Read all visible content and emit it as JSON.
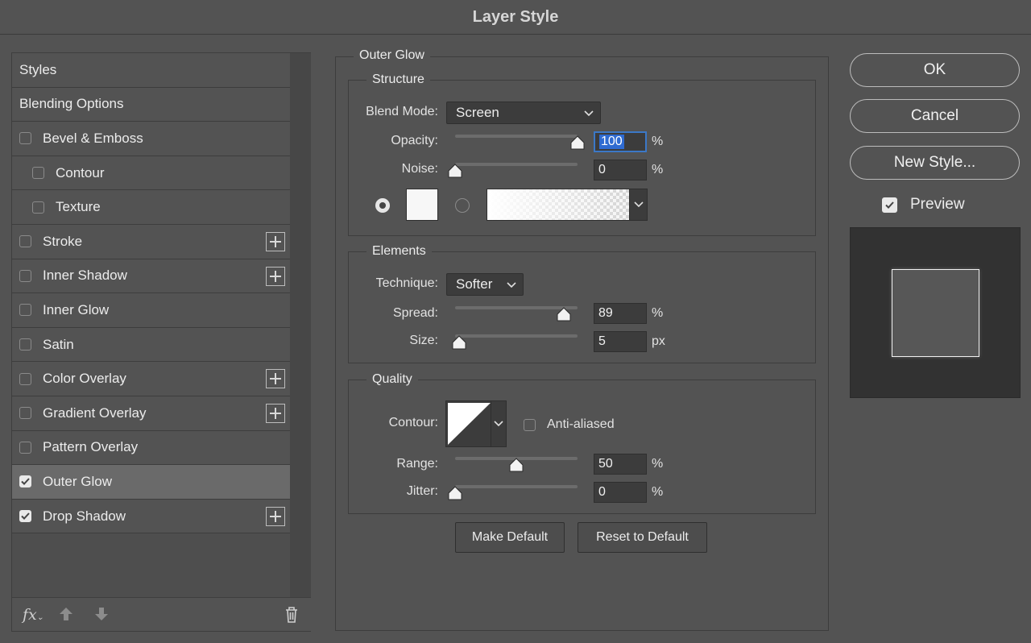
{
  "window": {
    "title": "Layer Style"
  },
  "style_list": {
    "items": [
      {
        "label": "Styles",
        "checkbox": false,
        "checked": false,
        "indent": false,
        "plus": false,
        "selected": false
      },
      {
        "label": "Blending Options",
        "checkbox": false,
        "checked": false,
        "indent": false,
        "plus": false,
        "selected": false
      },
      {
        "label": "Bevel & Emboss",
        "checkbox": true,
        "checked": false,
        "indent": false,
        "plus": false,
        "selected": false
      },
      {
        "label": "Contour",
        "checkbox": true,
        "checked": false,
        "indent": true,
        "plus": false,
        "selected": false
      },
      {
        "label": "Texture",
        "checkbox": true,
        "checked": false,
        "indent": true,
        "plus": false,
        "selected": false
      },
      {
        "label": "Stroke",
        "checkbox": true,
        "checked": false,
        "indent": false,
        "plus": true,
        "selected": false
      },
      {
        "label": "Inner Shadow",
        "checkbox": true,
        "checked": false,
        "indent": false,
        "plus": true,
        "selected": false
      },
      {
        "label": "Inner Glow",
        "checkbox": true,
        "checked": false,
        "indent": false,
        "plus": false,
        "selected": false
      },
      {
        "label": "Satin",
        "checkbox": true,
        "checked": false,
        "indent": false,
        "plus": false,
        "selected": false
      },
      {
        "label": "Color Overlay",
        "checkbox": true,
        "checked": false,
        "indent": false,
        "plus": true,
        "selected": false
      },
      {
        "label": "Gradient Overlay",
        "checkbox": true,
        "checked": false,
        "indent": false,
        "plus": true,
        "selected": false
      },
      {
        "label": "Pattern Overlay",
        "checkbox": true,
        "checked": false,
        "indent": false,
        "plus": false,
        "selected": false
      },
      {
        "label": "Outer Glow",
        "checkbox": true,
        "checked": true,
        "indent": false,
        "plus": false,
        "selected": true
      },
      {
        "label": "Drop Shadow",
        "checkbox": true,
        "checked": true,
        "indent": false,
        "plus": true,
        "selected": false
      }
    ],
    "bottom_icons": [
      "fx-icon",
      "move-up-icon",
      "move-down-icon",
      "trash-icon"
    ],
    "fx_label": "fx"
  },
  "outer_glow": {
    "title": "Outer Glow",
    "structure": {
      "title": "Structure",
      "blend_mode_label": "Blend Mode:",
      "blend_mode_value": "Screen",
      "opacity_label": "Opacity:",
      "opacity_value": "100",
      "opacity_unit": "%",
      "opacity_fraction": 1.0,
      "noise_label": "Noise:",
      "noise_value": "0",
      "noise_unit": "%",
      "noise_fraction": 0.0,
      "color_mode": "solid",
      "glow_color": "#f7f7f7"
    },
    "elements": {
      "title": "Elements",
      "technique_label": "Technique:",
      "technique_value": "Softer",
      "spread_label": "Spread:",
      "spread_value": "89",
      "spread_unit": "%",
      "spread_fraction": 0.89,
      "size_label": "Size:",
      "size_value": "5",
      "size_unit": "px",
      "size_fraction": 0.03
    },
    "quality": {
      "title": "Quality",
      "contour_label": "Contour:",
      "anti_aliased_label": "Anti-aliased",
      "anti_aliased": false,
      "range_label": "Range:",
      "range_value": "50",
      "range_unit": "%",
      "range_fraction": 0.5,
      "jitter_label": "Jitter:",
      "jitter_value": "0",
      "jitter_unit": "%",
      "jitter_fraction": 0.0
    },
    "make_default_label": "Make Default",
    "reset_default_label": "Reset to Default"
  },
  "actions": {
    "ok_label": "OK",
    "cancel_label": "Cancel",
    "new_style_label": "New Style...",
    "preview_label": "Preview",
    "preview_checked": true
  },
  "colors": {
    "dialog_bg": "#535353",
    "selected_row": "#6a6a6a",
    "focus_blue": "#3b78c7"
  }
}
